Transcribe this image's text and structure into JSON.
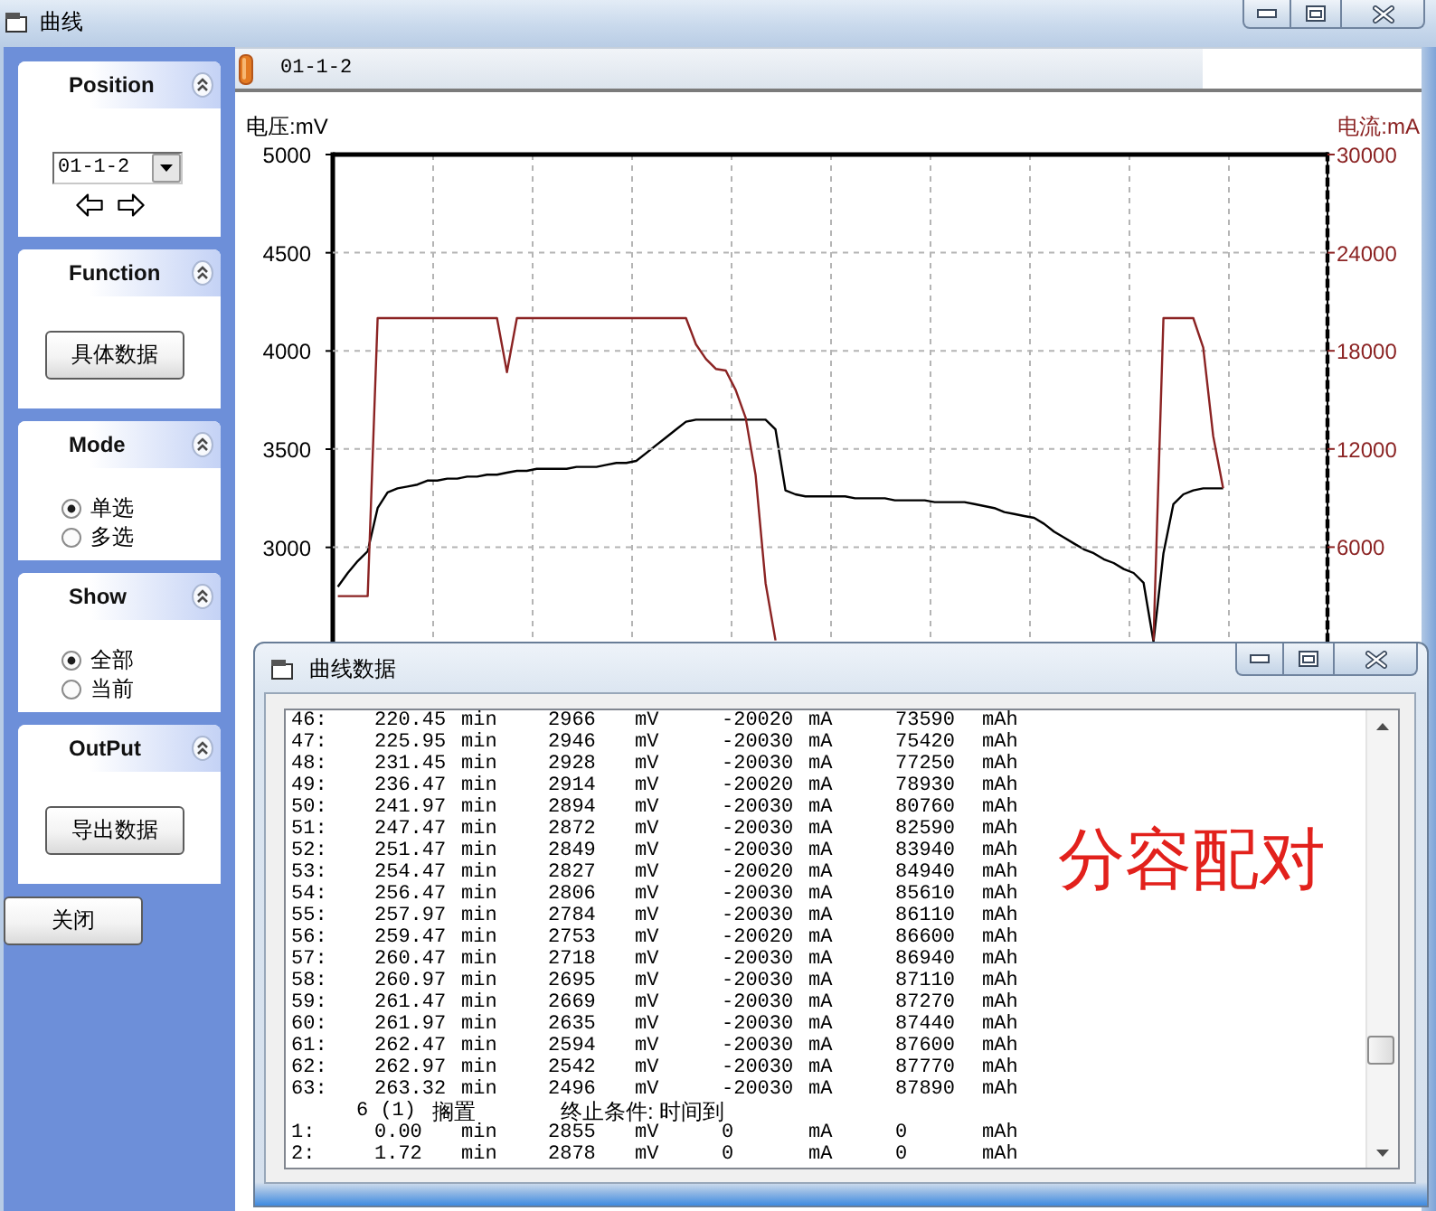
{
  "window": {
    "title": "曲线"
  },
  "sidebar": {
    "panels": [
      {
        "kind": "position",
        "title": "Position",
        "expanded": true,
        "dropdown": {
          "value": "01-1-2"
        }
      },
      {
        "kind": "button",
        "title": "Function",
        "expanded": true,
        "button": "具体数据"
      },
      {
        "kind": "radios",
        "title": "Mode",
        "expanded": true,
        "options": [
          {
            "label": "单选",
            "selected": true
          },
          {
            "label": "多选",
            "selected": false
          }
        ]
      },
      {
        "kind": "radios",
        "title": "Show",
        "expanded": true,
        "options": [
          {
            "label": "全部",
            "selected": true
          },
          {
            "label": "当前",
            "selected": false
          }
        ]
      },
      {
        "kind": "button",
        "title": "OutPut",
        "expanded": true,
        "button": "导出数据"
      }
    ],
    "close_button": "关闭"
  },
  "tab": {
    "label": "01-1-2"
  },
  "chart": {
    "layers": [
      {
        "kind": "left",
        "chart_data": {
          "type": "line",
          "ylabel": "电压:mV",
          "ylim": [
            2520,
            5000
          ],
          "yticks": [
            3000,
            3500,
            4000,
            4500,
            5000
          ],
          "grid": true,
          "categories": [
            null,
            null,
            null,
            null,
            null,
            null,
            null,
            null,
            null,
            null,
            null,
            null,
            null,
            null,
            null,
            null,
            null,
            null,
            null,
            null,
            null,
            null,
            null,
            null,
            null,
            null,
            null,
            null,
            null,
            null,
            null,
            null,
            null,
            null,
            null,
            null,
            null,
            null,
            null,
            null,
            null,
            null,
            null,
            null,
            null,
            null,
            null,
            null,
            null,
            null,
            null,
            null,
            null,
            null,
            null,
            null,
            null,
            null,
            null,
            null,
            null,
            null,
            null,
            null,
            null,
            null,
            null,
            null,
            null,
            null,
            null,
            null,
            null,
            null,
            null,
            null,
            null,
            null,
            null,
            null,
            null,
            null,
            null,
            null,
            null,
            null,
            null,
            null,
            null,
            null,
            null,
            null,
            null,
            null,
            null,
            null,
            null,
            null,
            null,
            null
          ],
          "series": [
            {
              "color": "#000000",
              "values": [
                2800,
                2870,
                2930,
                2980,
                3200,
                3280,
                3300,
                3310,
                3320,
                3340,
                3340,
                3350,
                3350,
                3360,
                3360,
                3370,
                3370,
                3380,
                3390,
                3390,
                3400,
                3400,
                3400,
                3400,
                3410,
                3410,
                3410,
                3420,
                3430,
                3430,
                3440,
                3480,
                3520,
                3560,
                3600,
                3640,
                3650,
                3650,
                3650,
                3650,
                3650,
                3650,
                3650,
                3650,
                3600,
                3290,
                3270,
                3260,
                3260,
                3260,
                3260,
                3260,
                3250,
                3250,
                3250,
                3250,
                3240,
                3240,
                3240,
                3240,
                3230,
                3230,
                3230,
                3230,
                3220,
                3210,
                3200,
                3180,
                3170,
                3160,
                3150,
                3120,
                3080,
                3050,
                3020,
                2990,
                2970,
                2940,
                2920,
                2890,
                2870,
                2820,
                2520,
                2970,
                3220,
                3270,
                3290,
                3300,
                3300,
                3300,
                null,
                null,
                null,
                null,
                null,
                null,
                null,
                null,
                null,
                null
              ]
            }
          ]
        }
      },
      {
        "kind": "right",
        "chart_data": {
          "type": "line",
          "ylabel": "电流:mA",
          "ylim": [
            220,
            30000
          ],
          "yticks": [
            6000,
            12000,
            18000,
            24000,
            30000
          ],
          "grid": true,
          "categories": [
            null,
            null,
            null,
            null,
            null,
            null,
            null,
            null,
            null,
            null,
            null,
            null,
            null,
            null,
            null,
            null,
            null,
            null,
            null,
            null,
            null,
            null,
            null,
            null,
            null,
            null,
            null,
            null,
            null,
            null,
            null,
            null,
            null,
            null,
            null,
            null,
            null,
            null,
            null,
            null,
            null,
            null,
            null,
            null,
            null,
            null,
            null,
            null,
            null,
            null,
            null,
            null,
            null,
            null,
            null,
            null,
            null,
            null,
            null,
            null,
            null,
            null,
            null,
            null,
            null,
            null,
            null,
            null,
            null,
            null,
            null,
            null,
            null,
            null,
            null,
            null,
            null,
            null,
            null,
            null,
            null,
            null,
            null,
            null,
            null,
            null,
            null,
            null,
            null,
            null,
            null,
            null,
            null,
            null,
            null,
            null,
            null,
            null,
            null,
            null
          ],
          "series": [
            {
              "color": "#8b2323",
              "values": [
                3000,
                3000,
                3000,
                3000,
                20000,
                20000,
                20000,
                20000,
                20000,
                20000,
                20000,
                20000,
                20000,
                20000,
                20000,
                20000,
                20000,
                16700,
                20000,
                20000,
                20000,
                20000,
                20000,
                20000,
                20000,
                20000,
                20000,
                20000,
                20000,
                20000,
                20000,
                20000,
                20000,
                20000,
                20000,
                20000,
                18400,
                17500,
                16900,
                16800,
                15600,
                13900,
                10400,
                3800,
                300,
                null,
                null,
                null,
                null,
                null,
                null,
                null,
                null,
                null,
                null,
                null,
                null,
                null,
                null,
                null,
                null,
                null,
                null,
                null,
                null,
                null,
                null,
                null,
                null,
                null,
                null,
                null,
                null,
                null,
                null,
                null,
                null,
                null,
                null,
                null,
                null,
                null,
                null,
                null,
                null,
                null,
                null,
                null,
                null,
                null,
                null,
                null,
                null,
                null,
                null,
                null,
                null,
                null,
                null,
                null
              ]
            },
            {
              "color": "#8b2323",
              "values": [
                null,
                null,
                null,
                null,
                null,
                null,
                null,
                null,
                null,
                null,
                null,
                null,
                null,
                null,
                null,
                null,
                null,
                null,
                null,
                null,
                null,
                null,
                null,
                null,
                null,
                null,
                null,
                null,
                null,
                null,
                null,
                null,
                null,
                null,
                null,
                null,
                null,
                null,
                null,
                null,
                null,
                null,
                null,
                null,
                null,
                null,
                null,
                null,
                null,
                null,
                null,
                null,
                null,
                null,
                null,
                null,
                null,
                null,
                null,
                null,
                null,
                null,
                null,
                null,
                null,
                null,
                null,
                null,
                null,
                null,
                null,
                null,
                null,
                null,
                null,
                null,
                null,
                null,
                null,
                null,
                null,
                null,
                300,
                20000,
                20000,
                20000,
                20000,
                18200,
                12800,
                9600,
                null,
                null,
                null,
                null,
                null,
                null,
                null,
                null,
                null,
                null
              ]
            }
          ]
        }
      }
    ]
  },
  "data_window": {
    "title": "曲线数据",
    "rows": [
      {
        "kind": "data",
        "cells": [
          "46:",
          "220.45",
          "min",
          "2966",
          "mV",
          "-20020",
          "mA",
          "73590",
          "mAh"
        ]
      },
      {
        "kind": "data",
        "cells": [
          "47:",
          "225.95",
          "min",
          "2946",
          "mV",
          "-20030",
          "mA",
          "75420",
          "mAh"
        ]
      },
      {
        "kind": "data",
        "cells": [
          "48:",
          "231.45",
          "min",
          "2928",
          "mV",
          "-20030",
          "mA",
          "77250",
          "mAh"
        ]
      },
      {
        "kind": "data",
        "cells": [
          "49:",
          "236.47",
          "min",
          "2914",
          "mV",
          "-20020",
          "mA",
          "78930",
          "mAh"
        ]
      },
      {
        "kind": "data",
        "cells": [
          "50:",
          "241.97",
          "min",
          "2894",
          "mV",
          "-20030",
          "mA",
          "80760",
          "mAh"
        ]
      },
      {
        "kind": "data",
        "cells": [
          "51:",
          "247.47",
          "min",
          "2872",
          "mV",
          "-20030",
          "mA",
          "82590",
          "mAh"
        ]
      },
      {
        "kind": "data",
        "cells": [
          "52:",
          "251.47",
          "min",
          "2849",
          "mV",
          "-20030",
          "mA",
          "83940",
          "mAh"
        ]
      },
      {
        "kind": "data",
        "cells": [
          "53:",
          "254.47",
          "min",
          "2827",
          "mV",
          "-20020",
          "mA",
          "84940",
          "mAh"
        ]
      },
      {
        "kind": "data",
        "cells": [
          "54:",
          "256.47",
          "min",
          "2806",
          "mV",
          "-20030",
          "mA",
          "85610",
          "mAh"
        ]
      },
      {
        "kind": "data",
        "cells": [
          "55:",
          "257.97",
          "min",
          "2784",
          "mV",
          "-20030",
          "mA",
          "86110",
          "mAh"
        ]
      },
      {
        "kind": "data",
        "cells": [
          "56:",
          "259.47",
          "min",
          "2753",
          "mV",
          "-20020",
          "mA",
          "86600",
          "mAh"
        ]
      },
      {
        "kind": "data",
        "cells": [
          "57:",
          "260.47",
          "min",
          "2718",
          "mV",
          "-20030",
          "mA",
          "86940",
          "mAh"
        ]
      },
      {
        "kind": "data",
        "cells": [
          "58:",
          "260.97",
          "min",
          "2695",
          "mV",
          "-20030",
          "mA",
          "87110",
          "mAh"
        ]
      },
      {
        "kind": "data",
        "cells": [
          "59:",
          "261.47",
          "min",
          "2669",
          "mV",
          "-20030",
          "mA",
          "87270",
          "mAh"
        ]
      },
      {
        "kind": "data",
        "cells": [
          "60:",
          "261.97",
          "min",
          "2635",
          "mV",
          "-20030",
          "mA",
          "87440",
          "mAh"
        ]
      },
      {
        "kind": "data",
        "cells": [
          "61:",
          "262.47",
          "min",
          "2594",
          "mV",
          "-20030",
          "mA",
          "87600",
          "mAh"
        ]
      },
      {
        "kind": "data",
        "cells": [
          "62:",
          "262.97",
          "min",
          "2542",
          "mV",
          "-20030",
          "mA",
          "87770",
          "mAh"
        ]
      },
      {
        "kind": "data",
        "cells": [
          "63:",
          "263.32",
          "min",
          "2496",
          "mV",
          "-20030",
          "mA",
          "87890",
          "mAh"
        ]
      },
      {
        "kind": "step",
        "step": "6 (1)",
        "state": "搁置",
        "condition": "终止条件: 时间到"
      },
      {
        "kind": "data",
        "cells": [
          "1:",
          "0.00",
          "min",
          "2855",
          "mV",
          "0",
          "mA",
          "0",
          "mAh"
        ]
      },
      {
        "kind": "data",
        "cells": [
          "2:",
          "1.72",
          "min",
          "2878",
          "mV",
          "0",
          "mA",
          "0",
          "mAh"
        ]
      }
    ],
    "annotation": "分容配对"
  }
}
